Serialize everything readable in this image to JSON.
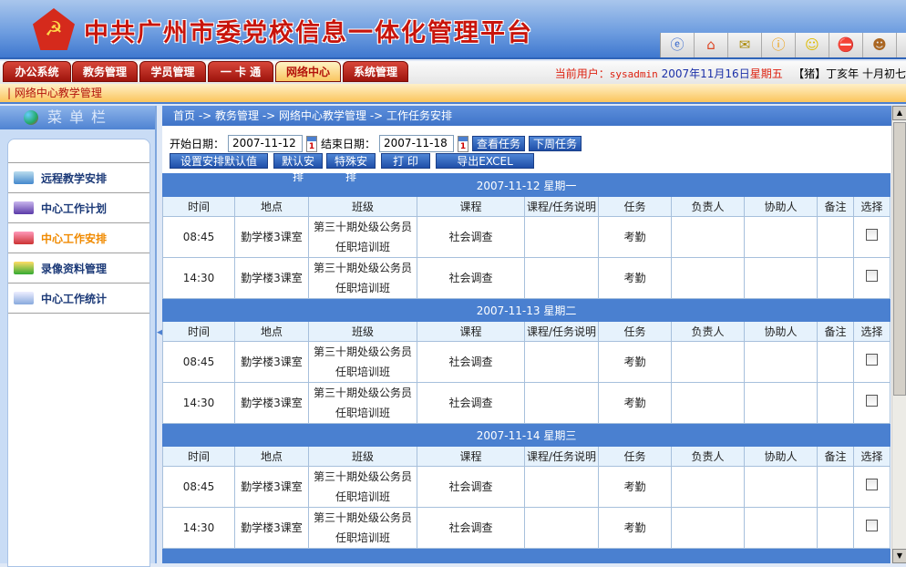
{
  "header": {
    "title": "中共广州市委党校信息一体化管理平台",
    "toolbar_icons": [
      "ie-icon",
      "home-icon",
      "mail-icon",
      "info-icon",
      "smile-icon",
      "stop-icon",
      "user-icon"
    ]
  },
  "tabs": [
    {
      "label": "办公系统"
    },
    {
      "label": "教务管理"
    },
    {
      "label": "学员管理"
    },
    {
      "label": "一 卡 通"
    },
    {
      "label": "网络中心",
      "active": true
    },
    {
      "label": "系统管理"
    }
  ],
  "user_bar": {
    "label": "当前用户：",
    "user": "sysadmin",
    "date": "2007年11月16日",
    "weekday": "星期五",
    "lunar": "【猪】丁亥年 十月初七"
  },
  "subnav": "| 网络中心教学管理",
  "sidebar": {
    "title": "菜单栏",
    "items": [
      {
        "label": "远程教学安排"
      },
      {
        "label": "中心工作计划"
      },
      {
        "label": "中心工作安排",
        "selected": true
      },
      {
        "label": "录像资料管理"
      },
      {
        "label": "中心工作统计"
      }
    ]
  },
  "breadcrumb": "首页 -> 教务管理 -> 网络中心教学管理 -> 工作任务安排",
  "filters": {
    "start_label": "开始日期：",
    "start": "2007-11-12",
    "end_label": "结束日期：",
    "end": "2007-11-18"
  },
  "buttons": {
    "view": "查看任务",
    "next_week": "下周任务",
    "set_default": "设置安排默认值",
    "default": "默认安排",
    "special": "特殊安排",
    "print": "打 印",
    "export": "导出EXCEL"
  },
  "columns": [
    "时间",
    "地点",
    "班级",
    "课程",
    "课程/任务说明",
    "任务",
    "负责人",
    "协助人",
    "备注",
    "选择"
  ],
  "days": [
    {
      "header": "2007-11-12 星期一",
      "rows": [
        {
          "time": "08:45",
          "place": "勤学楼3课室",
          "class": "第三十期处级公务员任职培训班",
          "course": "社会调查",
          "desc": "",
          "task": "考勤",
          "owner": "",
          "assist": "",
          "note": ""
        },
        {
          "time": "14:30",
          "place": "勤学楼3课室",
          "class": "第三十期处级公务员任职培训班",
          "course": "社会调查",
          "desc": "",
          "task": "考勤",
          "owner": "",
          "assist": "",
          "note": ""
        }
      ]
    },
    {
      "header": "2007-11-13 星期二",
      "rows": [
        {
          "time": "08:45",
          "place": "勤学楼3课室",
          "class": "第三十期处级公务员任职培训班",
          "course": "社会调查",
          "desc": "",
          "task": "考勤",
          "owner": "",
          "assist": "",
          "note": ""
        },
        {
          "time": "14:30",
          "place": "勤学楼3课室",
          "class": "第三十期处级公务员任职培训班",
          "course": "社会调查",
          "desc": "",
          "task": "考勤",
          "owner": "",
          "assist": "",
          "note": ""
        }
      ]
    },
    {
      "header": "2007-11-14 星期三",
      "rows": [
        {
          "time": "08:45",
          "place": "勤学楼3课室",
          "class": "第三十期处级公务员任职培训班",
          "course": "社会调查",
          "desc": "",
          "task": "考勤",
          "owner": "",
          "assist": "",
          "note": ""
        },
        {
          "time": "14:30",
          "place": "勤学楼3课室",
          "class": "第三十期处级公务员任职培训班",
          "course": "社会调查",
          "desc": "",
          "task": "考勤",
          "owner": "",
          "assist": "",
          "note": ""
        }
      ]
    }
  ]
}
